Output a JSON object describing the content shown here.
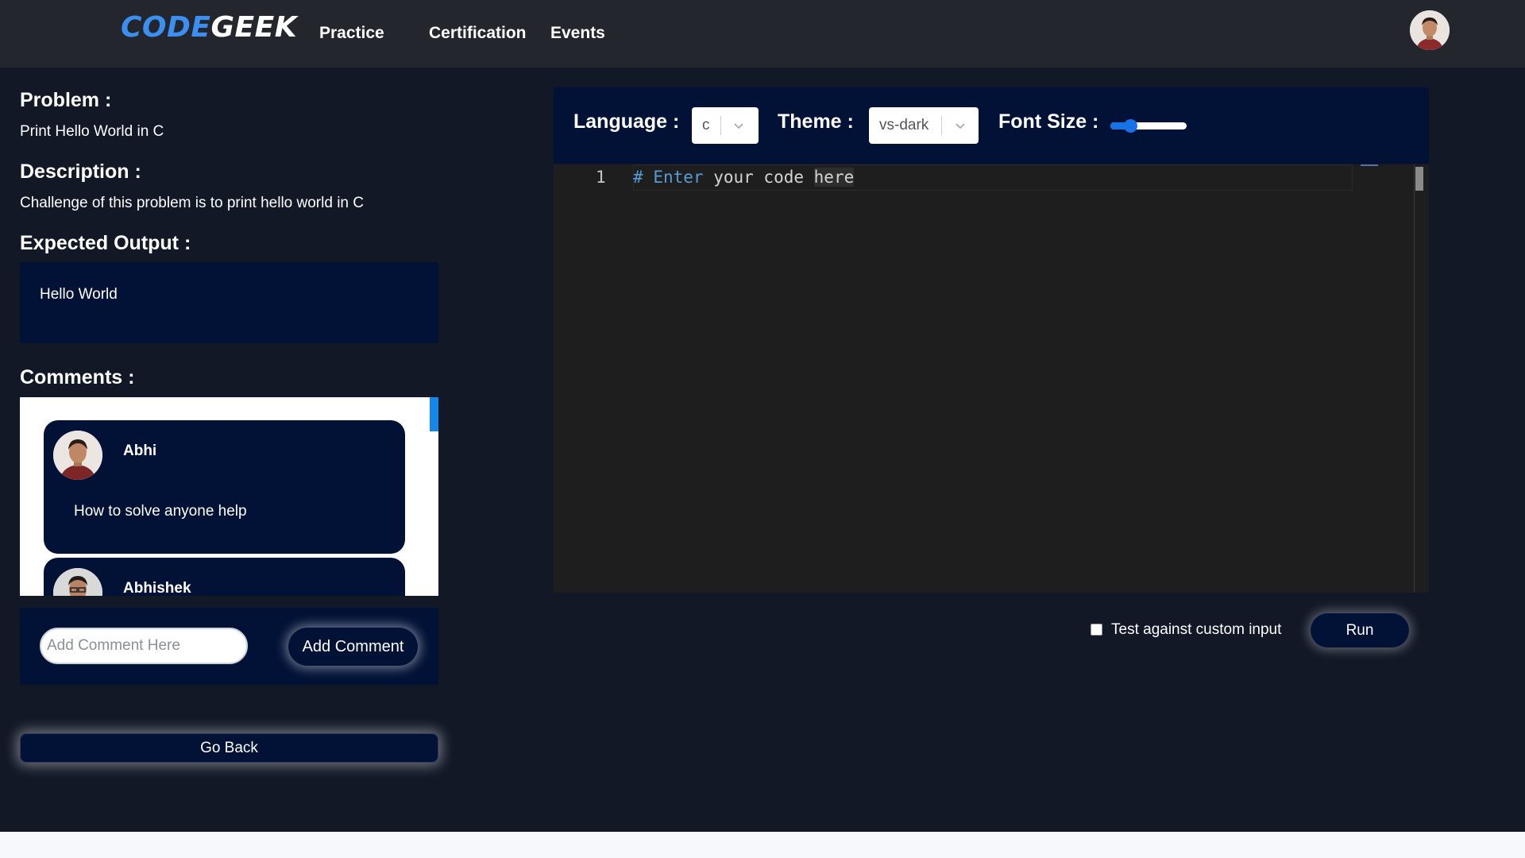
{
  "nav": {
    "logo_part1": "CODE",
    "logo_part2": "GEEK",
    "links": [
      "Practice",
      "Certification",
      "Events"
    ]
  },
  "problem": {
    "title_label": "Problem :",
    "title": "Print Hello World in C",
    "description_label": "Description :",
    "description": "Challenge of this problem is to print hello world in C",
    "expected_output_label": "Expected Output :",
    "expected_output": "Hello World"
  },
  "comments": {
    "label": "Comments :",
    "items": [
      {
        "author": "Abhi",
        "text": "How to solve anyone help"
      },
      {
        "author": "Abhishek",
        "text": ""
      }
    ],
    "input_placeholder": "Add Comment Here",
    "add_button": "Add Comment"
  },
  "go_back": "Go Back",
  "editor": {
    "language_label": "Language :",
    "language_value": "c",
    "theme_label": "Theme :",
    "theme_value": "vs-dark",
    "font_size_label": "Font Size :",
    "font_size_fraction": 0.22,
    "line_number": "1",
    "code_tokens": [
      "#",
      "Enter",
      "your",
      "code",
      "here"
    ]
  },
  "run": {
    "custom_input_label": "Test against custom input",
    "custom_input_checked": false,
    "run_button": "Run"
  },
  "colors": {
    "accent_blue": "#3b8ff0",
    "panel_navy": "#021236",
    "page_bg": "#121826",
    "navbar_bg": "#23262d",
    "editor_bg": "#1e1e1e",
    "slider_blue": "#1673e6"
  },
  "icons": {
    "select_chevron": "chevron-down-icon",
    "user_avatar": "user-avatar-icon"
  }
}
